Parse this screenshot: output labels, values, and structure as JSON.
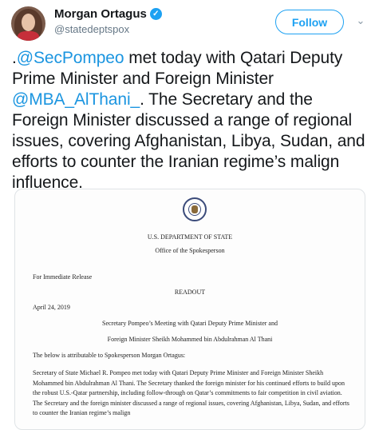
{
  "author": {
    "name": "Morgan Ortagus",
    "handle": "@statedeptspox"
  },
  "follow_label": "Follow",
  "tweet": {
    "p1": ".",
    "m1": "@SecPompeo",
    "p2": " met today with Qatari Deputy Prime Minister and Foreign Minister ",
    "m2": "@MBA_AlThani_",
    "p3": ". The Secretary and the Foreign Minister discussed a range of regional issues, covering Afghanistan, Libya, Sudan, and efforts to counter the Iranian regime’s malign influence."
  },
  "document": {
    "department": "U.S. DEPARTMENT OF STATE",
    "office": "Office of the Spokesperson",
    "release": "For Immediate Release",
    "readout": "READOUT",
    "date": "April 24, 2019",
    "title1": "Secretary Pompeo’s Meeting with Qatari Deputy Prime Minister and",
    "title2": "Foreign Minister Sheikh Mohammed bin Abdulrahman Al Thani",
    "attribution": "The below is attributable to Spokesperson Morgan Ortagus:",
    "body": "Secretary of State Michael R. Pompeo met today with Qatari Deputy Prime Minister and Foreign Minister Sheikh Mohammed bin Abdulrahman Al Thani.  The Secretary thanked the foreign minister for his continued efforts to build upon the robust U.S.-Qatar partnership, including follow-through on Qatar’s commitments to fair competition in civil aviation.  The Secretary and the foreign minister discussed a range of regional issues, covering Afghanistan, Libya, Sudan, and efforts to counter the Iranian regime’s malign"
  }
}
